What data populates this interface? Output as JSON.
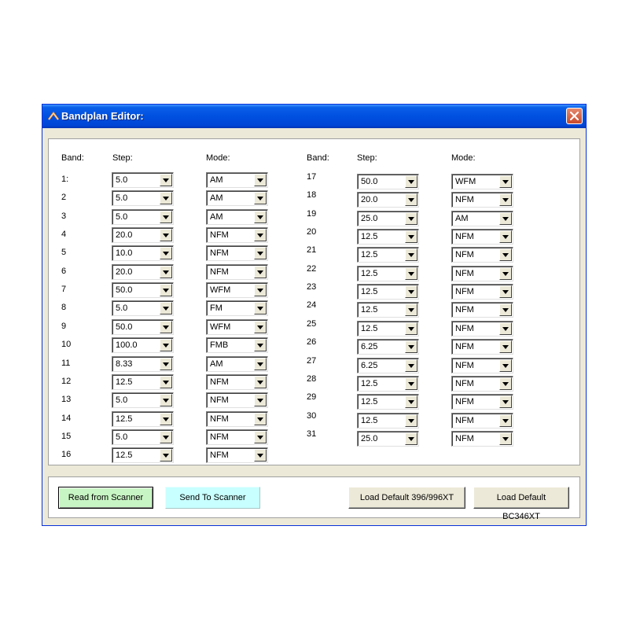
{
  "window": {
    "title": "Bandplan Editor:"
  },
  "headers": {
    "band": "Band:",
    "step": "Step:",
    "mode": "Mode:"
  },
  "bands": [
    {
      "band": "1:",
      "step": "5.0",
      "mode": "AM"
    },
    {
      "band": "2",
      "step": "5.0",
      "mode": "AM"
    },
    {
      "band": "3",
      "step": "5.0",
      "mode": "AM"
    },
    {
      "band": "4",
      "step": "20.0",
      "mode": "NFM"
    },
    {
      "band": "5",
      "step": "10.0",
      "mode": "NFM"
    },
    {
      "band": "6",
      "step": "20.0",
      "mode": "NFM"
    },
    {
      "band": "7",
      "step": "50.0",
      "mode": "WFM"
    },
    {
      "band": "8",
      "step": "5.0",
      "mode": "FM"
    },
    {
      "band": "9",
      "step": "50.0",
      "mode": "WFM"
    },
    {
      "band": "10",
      "step": "100.0",
      "mode": "FMB"
    },
    {
      "band": "11",
      "step": "8.33",
      "mode": "AM"
    },
    {
      "band": "12",
      "step": "12.5",
      "mode": "NFM"
    },
    {
      "band": "13",
      "step": "5.0",
      "mode": "NFM"
    },
    {
      "band": "14",
      "step": "12.5",
      "mode": "NFM"
    },
    {
      "band": "15",
      "step": "5.0",
      "mode": "NFM"
    },
    {
      "band": "16",
      "step": "12.5",
      "mode": "NFM"
    },
    {
      "band": "17",
      "step": "50.0",
      "mode": "WFM"
    },
    {
      "band": "18",
      "step": "20.0",
      "mode": "NFM"
    },
    {
      "band": "19",
      "step": "25.0",
      "mode": "AM"
    },
    {
      "band": "20",
      "step": "12.5",
      "mode": "NFM"
    },
    {
      "band": "21",
      "step": "12.5",
      "mode": "NFM"
    },
    {
      "band": "22",
      "step": "12.5",
      "mode": "NFM"
    },
    {
      "band": "23",
      "step": "12.5",
      "mode": "NFM"
    },
    {
      "band": "24",
      "step": "12.5",
      "mode": "NFM"
    },
    {
      "band": "25",
      "step": "12.5",
      "mode": "NFM"
    },
    {
      "band": "26",
      "step": "6.25",
      "mode": "NFM"
    },
    {
      "band": "27",
      "step": "6.25",
      "mode": "NFM"
    },
    {
      "band": "28",
      "step": "12.5",
      "mode": "NFM"
    },
    {
      "band": "29",
      "step": "12.5",
      "mode": "NFM"
    },
    {
      "band": "30",
      "step": "12.5",
      "mode": "NFM"
    },
    {
      "band": "31",
      "step": "25.0",
      "mode": "NFM"
    }
  ],
  "buttons": {
    "read": "Read from Scanner",
    "send": "Send To Scanner",
    "load_396": "Load Default 396/996XT",
    "load_346": "Load Default BC346XT"
  },
  "colors": {
    "titlebar": "#0050e0",
    "read_button": "#c8f5c4",
    "send_button": "#c8ffff",
    "close_button": "#c94a2a"
  },
  "icons": {
    "app": "scanner-app-icon",
    "close": "close-icon",
    "dropdown": "chevron-down-icon"
  }
}
